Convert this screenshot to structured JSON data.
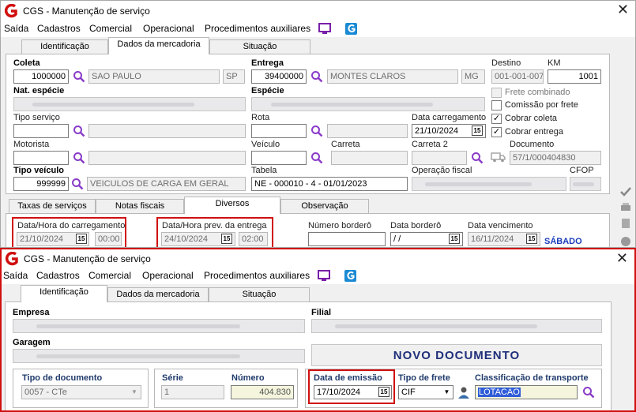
{
  "window1": {
    "title": "CGS - Manutenção de serviço",
    "menu": [
      "Saída",
      "Cadastros",
      "Comercial",
      "Operacional",
      "Procedimentos auxiliares"
    ],
    "tabs": [
      "Identificação",
      "Dados da mercadoria",
      "Situação"
    ],
    "coleta": {
      "label": "Coleta",
      "value": "1000000",
      "city": "SAO PAULO",
      "uf": "SP"
    },
    "entrega": {
      "label": "Entrega",
      "value": "39400000",
      "city": "MONTES CLAROS",
      "uf": "MG"
    },
    "destino": {
      "label": "Destino",
      "value": "001-001-007"
    },
    "km": {
      "label": "KM",
      "value": "1001"
    },
    "nat_especie": {
      "label": "Nat. espécie"
    },
    "especie": {
      "label": "Espécie"
    },
    "tipo_servico": {
      "label": "Tipo serviço"
    },
    "rota": {
      "label": "Rota"
    },
    "data_carregamento": {
      "label": "Data carregamento",
      "value": "21/10/2024"
    },
    "motorista": {
      "label": "Motorista"
    },
    "veiculo": {
      "label": "Veículo"
    },
    "carreta": {
      "label": "Carreta"
    },
    "carreta2": {
      "label": "Carreta 2"
    },
    "documento": {
      "label": "Documento",
      "value": "57/1/000404830"
    },
    "tipo_veiculo": {
      "label": "Tipo veículo",
      "value": "999999",
      "desc": "VEICULOS DE CARGA EM GERAL"
    },
    "tabela": {
      "label": "Tabela",
      "value": "NE - 000010 - 4 - 01/01/2023"
    },
    "operacao_fiscal": {
      "label": "Operação fiscal"
    },
    "cfop": {
      "label": "CFOP"
    },
    "checks": {
      "frete_combinado": "Frete combinado",
      "comissao_frete": "Comissão por frete",
      "cobrar_coleta": "Cobrar coleta",
      "cobrar_entrega": "Cobrar entrega"
    },
    "subtabs": [
      "Taxas de serviços",
      "Notas fiscais",
      "Diversos",
      "Observação"
    ],
    "dh_carregamento": {
      "label": "Data/Hora do carregamento",
      "date": "21/10/2024",
      "time": "00:00"
    },
    "dh_prev_entrega": {
      "label": "Data/Hora prev. da entrega",
      "date": "24/10/2024",
      "time": "02:00"
    },
    "numero_bordero": {
      "label": "Número borderô"
    },
    "data_bordero": {
      "label": "Data borderô",
      "value": " /  /"
    },
    "data_vencimento": {
      "label": "Data vencimento",
      "value": "16/11/2024"
    },
    "dia_semana": "SÁBADO"
  },
  "window2": {
    "title": "CGS - Manutenção de serviço",
    "menu": [
      "Saída",
      "Cadastros",
      "Comercial",
      "Operacional",
      "Procedimentos auxiliares"
    ],
    "tabs": [
      "Identificação",
      "Dados da mercadoria",
      "Situação"
    ],
    "empresa": {
      "label": "Empresa"
    },
    "filial": {
      "label": "Filial"
    },
    "garagem": {
      "label": "Garagem"
    },
    "novo_documento": "NOVO DOCUMENTO",
    "tipo_documento": {
      "label": "Tipo de documento",
      "value": "0057 - CTe"
    },
    "serie": {
      "label": "Série",
      "value": "1"
    },
    "numero": {
      "label": "Número",
      "value": "404.830"
    },
    "data_emissao": {
      "label": "Data de emissão",
      "value": "17/10/2024"
    },
    "tipo_frete": {
      "label": "Tipo de frete",
      "value": "CIF"
    },
    "classificacao": {
      "label": "Classificação de transporte",
      "value": "LOTACAO"
    }
  },
  "colors": {
    "highlight_red": "#d01010",
    "label_navy": "#1f3a6b",
    "weekday_blue": "#1a3cbe",
    "selection_blue": "#2f5cd8"
  },
  "icons": [
    "app-logo-icon",
    "monitor-icon",
    "g-app-icon",
    "magnifier-icon",
    "calendar-icon",
    "truck-icon",
    "person-icon",
    "close-icon",
    "dropdown-arrow-icon"
  ]
}
